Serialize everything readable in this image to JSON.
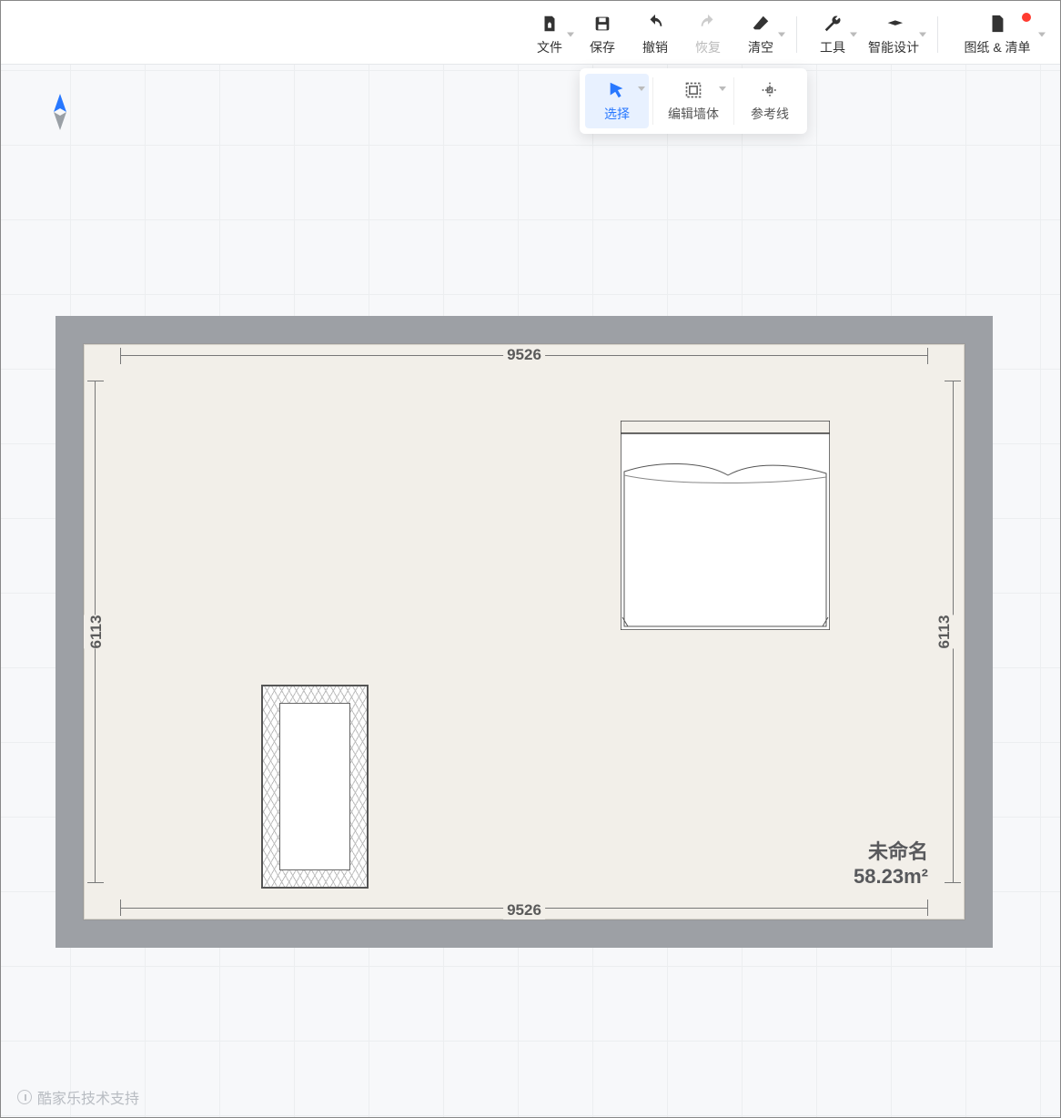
{
  "toolbar": {
    "file": "文件",
    "save": "保存",
    "undo": "撤销",
    "redo": "恢复",
    "clear": "清空",
    "tools": "工具",
    "ai": "智能设计",
    "export": "图纸 & 清单"
  },
  "subtoolbar": {
    "select": "选择",
    "edit_wall": "编辑墙体",
    "guide": "参考线"
  },
  "plan": {
    "width_dim_top": "9526",
    "width_dim_bottom": "9526",
    "height_dim_left": "6113",
    "height_dim_right": "6113",
    "room_name": "未命名",
    "room_area": "58.23m²"
  },
  "footer": {
    "support": "酷家乐技术支持"
  }
}
